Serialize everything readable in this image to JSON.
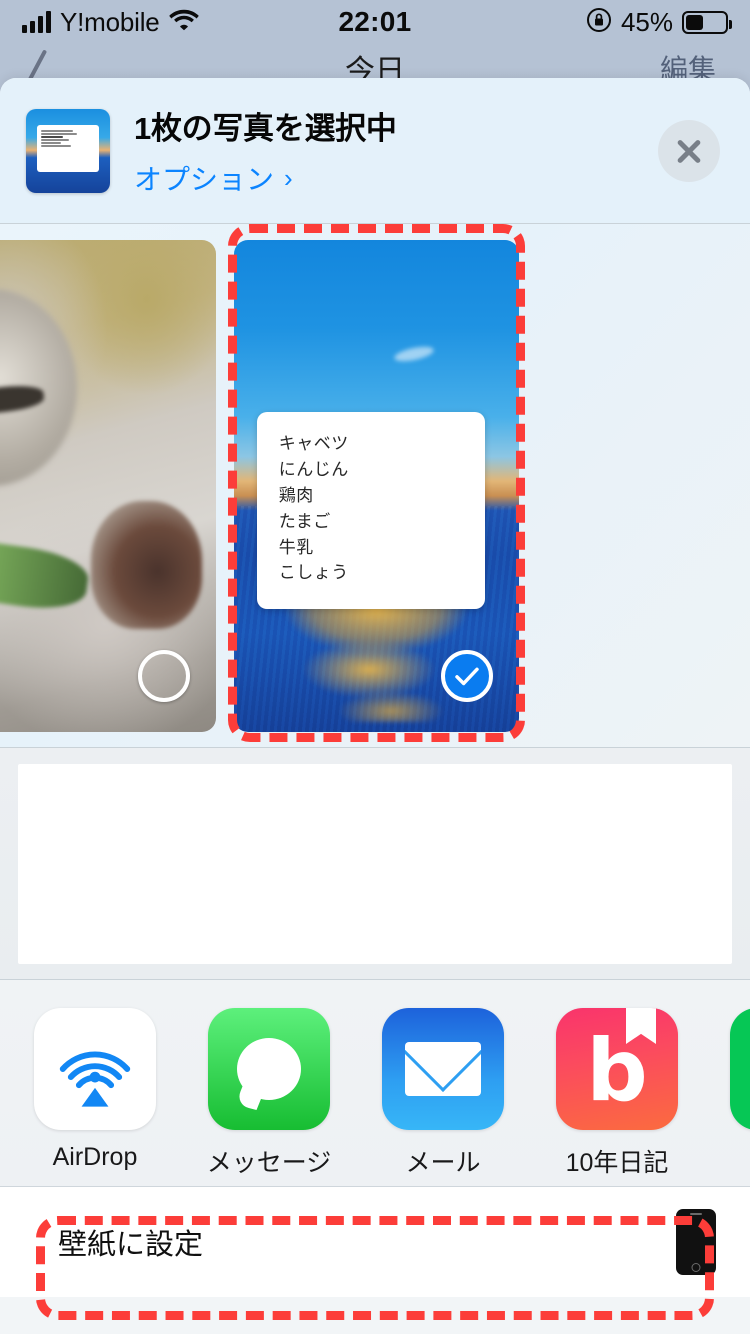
{
  "status_bar": {
    "carrier": "Y!mobile",
    "time": "22:01",
    "battery_percent": "45%",
    "wifi_icon": "wifi-icon",
    "signal_icon": "cellular-signal-icon",
    "orientation_lock_icon": "rotation-lock-icon",
    "battery_icon": "battery-icon",
    "battery_fill_ratio": 0.45
  },
  "background_app": {
    "nav_title": "今日",
    "nav_edit": "編集"
  },
  "share_sheet": {
    "header": {
      "title": "1枚の写真を選択中",
      "options_label": "オプション",
      "options_chevron": "›",
      "close_icon": "close-icon",
      "thumbnail_icon": "selected-photo-thumbnail"
    },
    "photos": [
      {
        "name": "kitten-photo",
        "selected": false,
        "selection_icon": "empty-circle-icon"
      },
      {
        "name": "sunset-memo-photo",
        "selected": true,
        "selection_icon": "blue-checkmark-icon",
        "memo_lines": [
          "キャベツ",
          "にんじん",
          "鶏肉",
          "たまご",
          "牛乳",
          "こしょう"
        ]
      }
    ],
    "apps": [
      {
        "label": "AirDrop",
        "icon": "airdrop-icon"
      },
      {
        "label": "メッセージ",
        "icon": "messages-icon"
      },
      {
        "label": "メール",
        "icon": "mail-icon"
      },
      {
        "label": "10年日記",
        "icon": "ten-year-diary-icon"
      },
      {
        "label": "",
        "icon": "line-icon"
      }
    ],
    "actions": [
      {
        "label": "壁紙に設定",
        "icon": "iphone-icon"
      }
    ]
  },
  "colors": {
    "ios_blue": "#0b84ff",
    "check_blue": "#0a7cf0",
    "header_bg": "#e4f1fa",
    "sheet_bg": "#f2f5f7",
    "annotation_red": "#fc3d39"
  }
}
